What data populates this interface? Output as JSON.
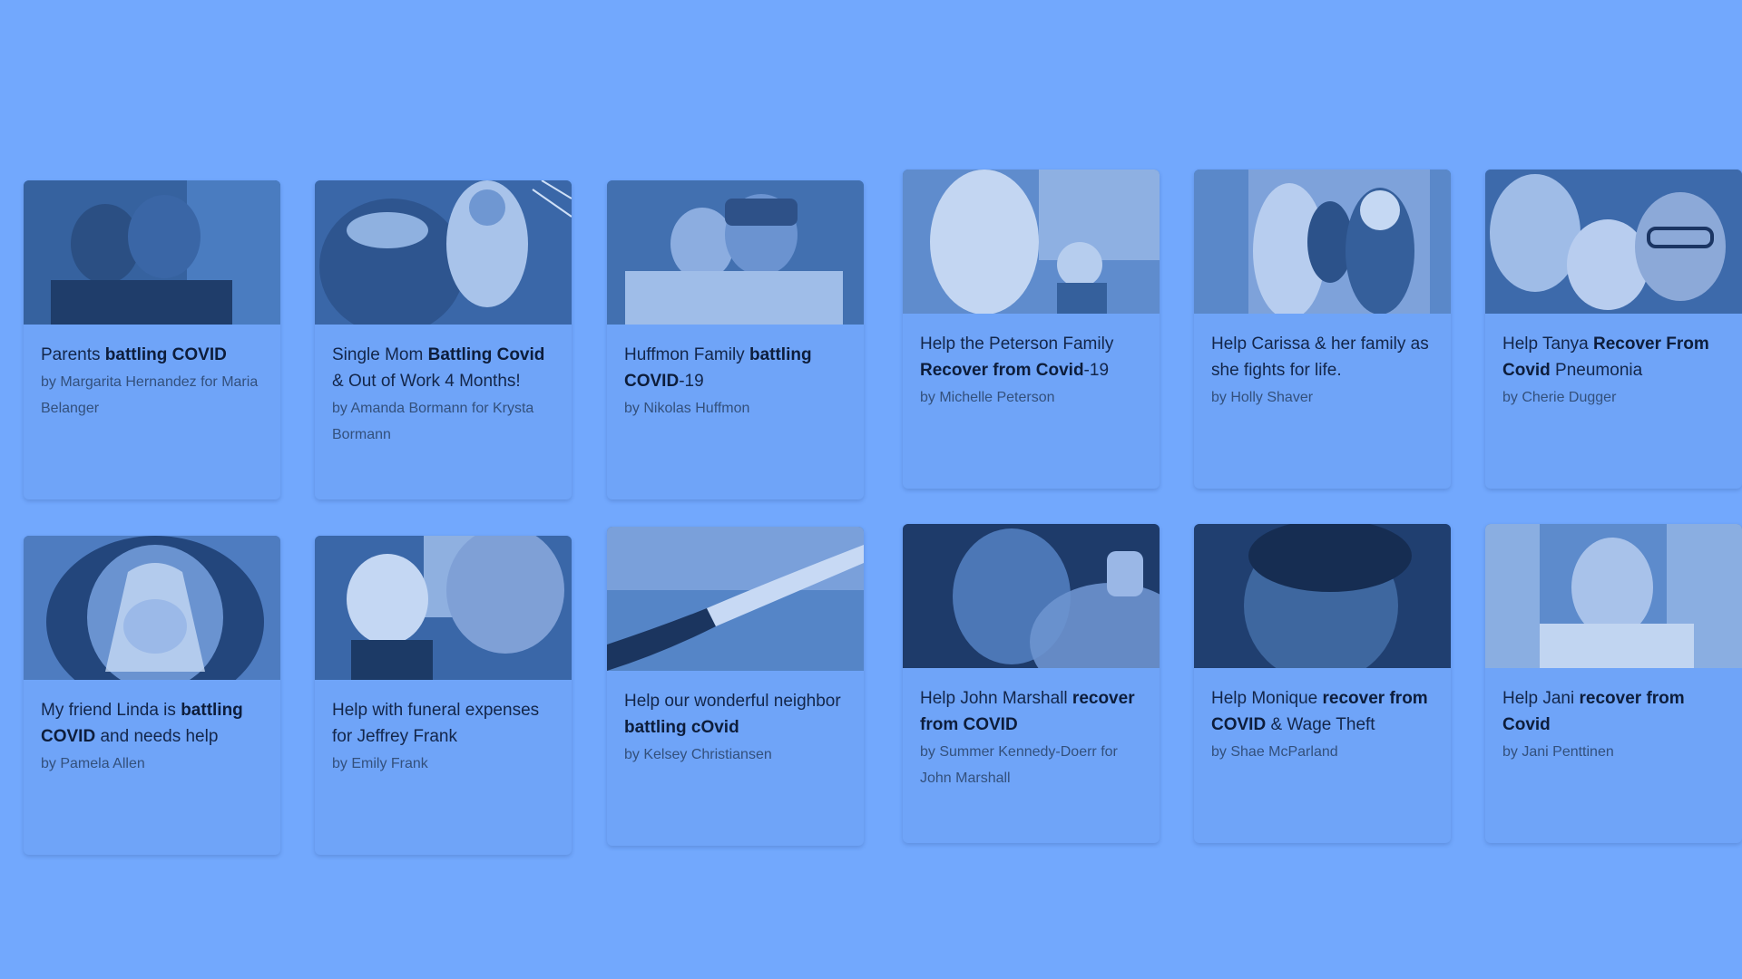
{
  "cards": [
    {
      "title_parts": [
        "Parents ",
        "battling COVID",
        ""
      ],
      "byline": "by Margarita Hernandez for Maria Belanger",
      "photo_alt": "couple-photo"
    },
    {
      "title_parts": [
        "Single Mom ",
        "Battling Covid",
        " & Out of Work 4 Months!"
      ],
      "byline": "by Amanda Bormann for Krysta Bormann",
      "photo_alt": "halloween-photo"
    },
    {
      "title_parts": [
        "Huffmon Family ",
        "battling COVID",
        "-19"
      ],
      "byline": "by Nikolas Huffmon",
      "photo_alt": "hospital-family-photo"
    },
    {
      "title_parts": [
        "Help the Peterson Family ",
        "Recover from Covid",
        "-19"
      ],
      "byline": "by Michelle Peterson",
      "photo_alt": "mother-daughter-photo"
    },
    {
      "title_parts": [
        "Help Carissa & her family as she fights for life.",
        "",
        ""
      ],
      "byline": "by Holly Shaver",
      "photo_alt": "family-christmas-photo"
    },
    {
      "title_parts": [
        "Help Tanya ",
        "Recover From Covid",
        " Pneumonia"
      ],
      "byline": "by Cherie Dugger",
      "photo_alt": "selfie-photo"
    },
    {
      "title_parts": [
        "My friend Linda is ",
        "battling COVID",
        " and needs help"
      ],
      "byline": "by Pamela Allen",
      "photo_alt": "oxygen-mask-photo"
    },
    {
      "title_parts": [
        "Help with funeral expenses for Jeffrey Frank",
        "",
        ""
      ],
      "byline": "by Emily Frank",
      "photo_alt": "grandfather-baby-photo"
    },
    {
      "title_parts": [
        "Help our wonderful neighbor ",
        "battling cOvid",
        ""
      ],
      "byline": "by Kelsey Christiansen",
      "photo_alt": "holding-hands-photo"
    },
    {
      "title_parts": [
        "Help John Marshall ",
        "recover from COVID",
        ""
      ],
      "byline": "by Summer Kennedy-Doerr for John Marshall",
      "photo_alt": "drummer-photo"
    },
    {
      "title_parts": [
        "Help Monique ",
        "recover from COVID",
        " & Wage Theft"
      ],
      "byline": "by Shae McParland",
      "photo_alt": "portrait-photo"
    },
    {
      "title_parts": [
        "Help Jani ",
        "recover from Covid",
        ""
      ],
      "byline": "by Jani Penttinen",
      "photo_alt": "hospital-bed-photo"
    }
  ]
}
